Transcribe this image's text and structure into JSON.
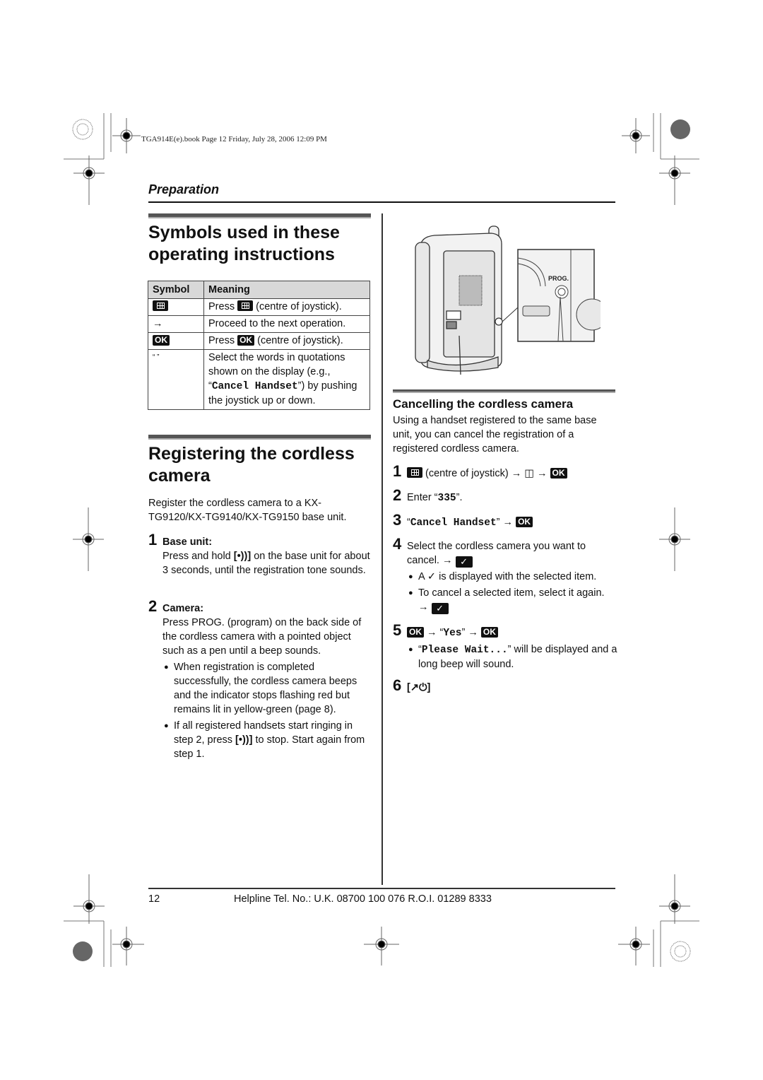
{
  "header": {
    "book_info": "TGA914E(e).book  Page 12  Friday, July 28, 2006  12:09 PM",
    "section": "Preparation"
  },
  "symbols_section": {
    "title_line1": "Symbols used in these",
    "title_line2": "operating instructions",
    "table": {
      "headers": [
        "Symbol",
        "Meaning"
      ],
      "rows": [
        {
          "symbol_icon": "menu-key-icon",
          "meaning_pre": "Press ",
          "meaning_icon": "menu-key-icon",
          "meaning_post": " (centre of joystick)."
        },
        {
          "symbol_text": "→",
          "meaning": "Proceed to the next operation."
        },
        {
          "symbol_text": "OK",
          "meaning_pre": "Press ",
          "meaning_key": "OK",
          "meaning_post": " (centre of joystick)."
        },
        {
          "symbol_text": "“ ”",
          "meaning_pre": "Select the words in quotations shown on the display (e.g., “",
          "meaning_mono": "Cancel Handset",
          "meaning_post": "”) by pushing the joystick up or down."
        }
      ]
    }
  },
  "register_section": {
    "title_line1": "Registering the cordless",
    "title_line2": "camera",
    "intro": "Register the cordless camera to a KX-TG9120/KX-TG9140/KX-TG9150 base unit.",
    "steps": [
      {
        "num": "1",
        "heading": "Base unit:",
        "text_pre": "Press and hold ",
        "key": "[•))]",
        "text_post": " on the base unit for about 3 seconds, until the registration tone sounds."
      },
      {
        "num": "2",
        "heading": "Camera:",
        "text": "Press PROG. (program) on the back side of the cordless camera with a pointed object such as a pen until a beep sounds.",
        "bullets": [
          "When registration is completed successfully, the cordless camera beeps and the indicator stops flashing red but remains lit in yellow-green (page 8).",
          {
            "pre": "If all registered handsets start ringing in step 2, press ",
            "key": "[•))]",
            "post": " to stop. Start again from step 1."
          }
        ]
      }
    ]
  },
  "illustration": {
    "label": "PROG.",
    "description": "Back of cordless camera with PROG. button detail"
  },
  "cancel_section": {
    "title": "Cancelling the cordless camera",
    "intro": "Using a handset registered to the same base unit, you can cancel the registration of a registered cordless camera.",
    "steps": [
      {
        "num": "1",
        "text": "(centre of joystick)",
        "arrow": "→",
        "key": "OK"
      },
      {
        "num": "2",
        "pre": "Enter “",
        "mono": "335",
        "post": "”."
      },
      {
        "num": "3",
        "mono": "Cancel Handset",
        "arrow": "→",
        "key": "OK"
      },
      {
        "num": "4",
        "text": "Select the cordless camera you want to cancel.",
        "arrow": "→",
        "bullets": [
          {
            "pre": "A ",
            "check": "✓",
            "post": " is displayed with the selected item."
          },
          {
            "pre": "To cancel a selected item, select it again.",
            "arrow": "→"
          }
        ]
      },
      {
        "num": "5",
        "key": "OK",
        "arrow": "→",
        "mono": "Yes",
        "bullets": [
          {
            "mono": "Please Wait...",
            "post": "” will be displayed and a long beep will sound."
          }
        ]
      },
      {
        "num": "6",
        "key_text": "[↗⏻]"
      }
    ]
  },
  "footer": {
    "page_number": "12",
    "helpline": "Helpline Tel. No.: U.K. 08700 100 076  R.O.I. 01289 8333"
  }
}
